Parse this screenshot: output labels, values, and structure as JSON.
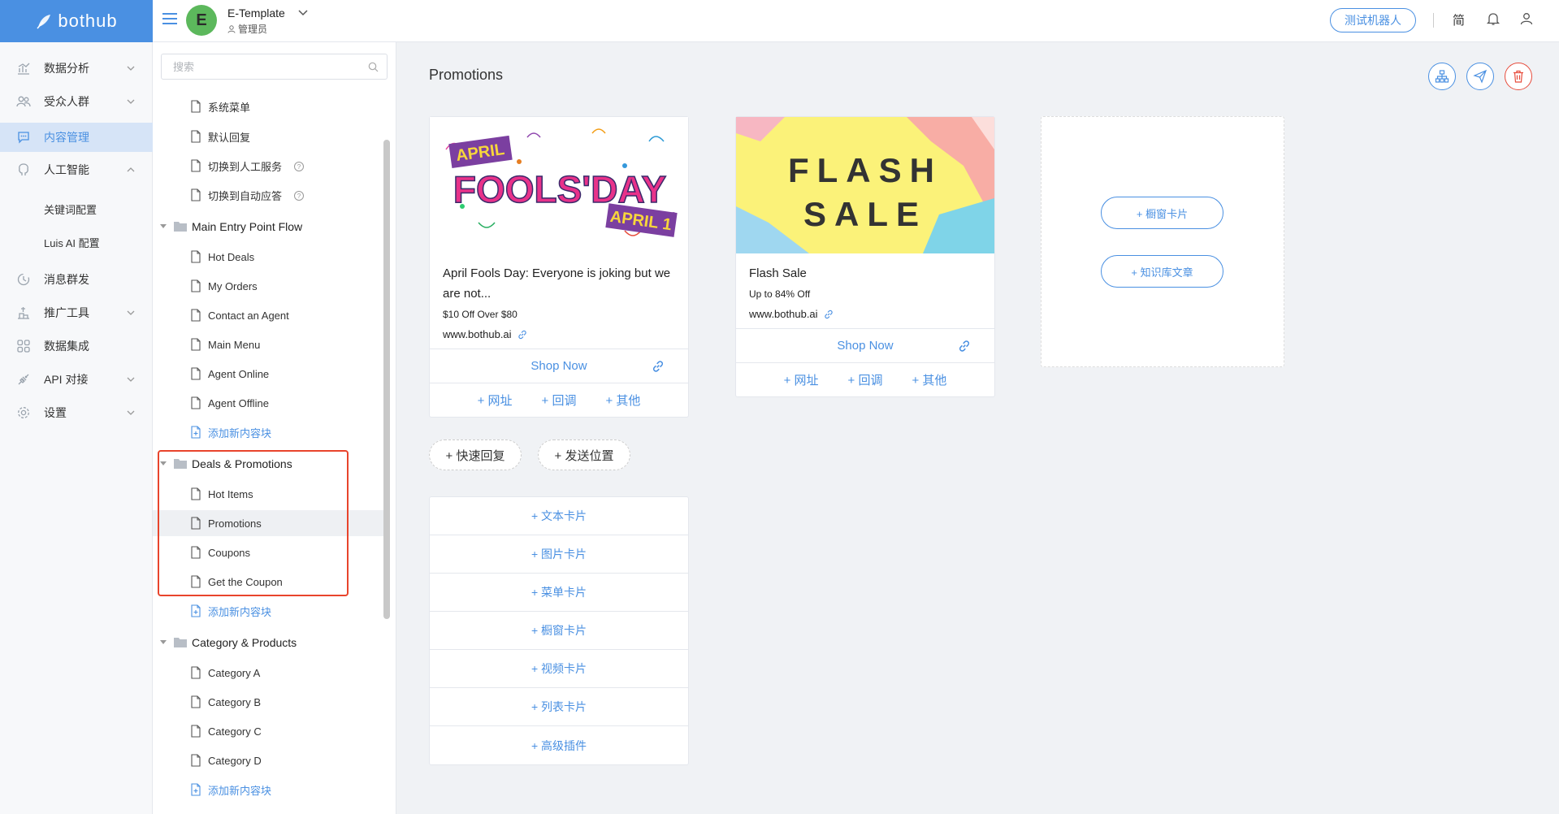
{
  "app": {
    "logo": "bothub"
  },
  "workspace": {
    "avatar_letter": "E",
    "name": "E-Template",
    "role": "管理员"
  },
  "header": {
    "test_bot": "测试机器人",
    "lang": "简"
  },
  "nav": {
    "items": [
      {
        "label": "数据分析",
        "icon": "chart-icon"
      },
      {
        "label": "受众人群",
        "icon": "users-icon"
      },
      {
        "label": "内容管理",
        "icon": "chat-icon"
      },
      {
        "label": "人工智能",
        "icon": "brain-icon"
      },
      {
        "label": "消息群发",
        "icon": "broadcast-icon"
      },
      {
        "label": "推广工具",
        "icon": "promotion-icon"
      },
      {
        "label": "数据集成",
        "icon": "grid-icon"
      },
      {
        "label": "API 对接",
        "icon": "api-icon"
      },
      {
        "label": "设置",
        "icon": "gear-icon"
      }
    ],
    "sub_ai": [
      "关键词配置",
      "Luis AI 配置"
    ]
  },
  "tree": {
    "search_placeholder": "搜索",
    "top_items": [
      "系统菜单",
      "默认回复",
      "切换到人工服务",
      "切换到自动应答"
    ],
    "groups": [
      {
        "name": "Main Entry Point Flow",
        "items": [
          "Hot Deals",
          "My Orders",
          "Contact an Agent",
          "Main Menu",
          "Agent Online",
          "Agent Offline"
        ],
        "add": "添加新内容块"
      },
      {
        "name": "Deals & Promotions",
        "items": [
          "Hot Items",
          "Promotions",
          "Coupons",
          "Get the Coupon"
        ],
        "add": "添加新内容块"
      },
      {
        "name": "Category & Products",
        "items": [
          "Category A",
          "Category B",
          "Category C",
          "Category D"
        ],
        "add": "添加新内容块"
      }
    ],
    "selected": "Promotions"
  },
  "main": {
    "title": "Promotions",
    "cards": [
      {
        "banner_lines": [
          "APRIL",
          "FOOLS'DAY",
          "APRIL 1"
        ],
        "title": "April Fools Day: Everyone is joking but we are not...",
        "subtitle": "$10 Off Over $80",
        "url": "www.bothub.ai",
        "button": "Shop Now",
        "actions": [
          "+ 网址",
          "+ 回调",
          "+ 其他"
        ]
      },
      {
        "banner_lines": [
          "FLASH",
          "SALE"
        ],
        "title": "Flash Sale",
        "subtitle": "Up to 84% Off",
        "url": "www.bothub.ai",
        "button": "Shop Now",
        "actions": [
          "+ 网址",
          "+ 回调",
          "+ 其他"
        ]
      }
    ],
    "empty_card_buttons": [
      "+ 橱窗卡片",
      "+ 知识库文章"
    ],
    "quick_replies": [
      "+ 快速回复",
      "+ 发送位置"
    ],
    "add_cards": [
      "+  文本卡片",
      "+  图片卡片",
      "+  菜单卡片",
      "+  橱窗卡片",
      "+  视频卡片",
      "+  列表卡片",
      "+  高级插件"
    ]
  }
}
